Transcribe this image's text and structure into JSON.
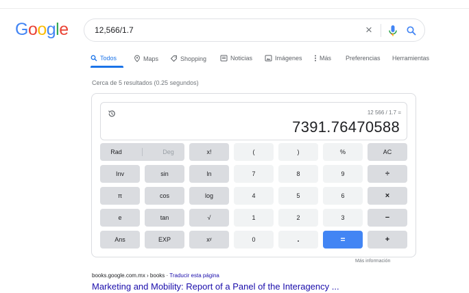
{
  "logo": {
    "letters": [
      "G",
      "o",
      "o",
      "g",
      "l",
      "e"
    ],
    "colors": [
      "#4285f4",
      "#ea4335",
      "#fbbc05",
      "#4285f4",
      "#34a853",
      "#ea4335"
    ]
  },
  "search": {
    "query": "12,566/1.7",
    "clear_icon": "×",
    "mic_icon": "mic-icon",
    "search_icon": "search-icon"
  },
  "tabs": [
    {
      "label": "Todos",
      "icon": "search-icon",
      "active": true
    },
    {
      "label": "Maps",
      "icon": "map-pin-icon",
      "active": false
    },
    {
      "label": "Shopping",
      "icon": "tag-icon",
      "active": false
    },
    {
      "label": "Noticias",
      "icon": "news-icon",
      "active": false
    },
    {
      "label": "Imágenes",
      "icon": "image-icon",
      "active": false
    },
    {
      "label": "Más",
      "icon": "more-vert-icon",
      "active": false
    },
    {
      "label": "Preferencias",
      "icon": "",
      "active": false
    },
    {
      "label": "Herramientas",
      "icon": "",
      "active": false
    }
  ],
  "result_stats": "Cerca de 5 resultados (0.25 segundos)",
  "calculator": {
    "expression": "12 566 / 1.7 =",
    "result": "7391.76470588",
    "rows": [
      [
        {
          "label": "Rad"
        },
        {
          "label": "Deg"
        },
        {
          "label": "x!"
        },
        {
          "label": "("
        },
        {
          "label": ")"
        },
        {
          "label": "%"
        },
        {
          "label": "AC"
        }
      ],
      [
        {
          "label": "Inv"
        },
        {
          "label": "sin"
        },
        {
          "label": "ln"
        },
        {
          "label": "7"
        },
        {
          "label": "8"
        },
        {
          "label": "9"
        },
        {
          "label": "÷"
        }
      ],
      [
        {
          "label": "π"
        },
        {
          "label": "cos"
        },
        {
          "label": "log"
        },
        {
          "label": "4"
        },
        {
          "label": "5"
        },
        {
          "label": "6"
        },
        {
          "label": "×"
        }
      ],
      [
        {
          "label": "e"
        },
        {
          "label": "tan"
        },
        {
          "label": "√"
        },
        {
          "label": "1"
        },
        {
          "label": "2"
        },
        {
          "label": "3"
        },
        {
          "label": "−"
        }
      ],
      [
        {
          "label": "Ans"
        },
        {
          "label": "EXP"
        },
        {
          "label": "xʸ"
        },
        {
          "label": "0"
        },
        {
          "label": "."
        },
        {
          "label": "="
        },
        {
          "label": "+"
        }
      ]
    ],
    "more_info": "Más información"
  },
  "result_item": {
    "cite": "books.google.com.mx › books",
    "cite_sep": " · ",
    "translate": "Traducir esta página",
    "title": "Marketing and Mobility: Report of a Panel of the Interagency ..."
  },
  "colors": {
    "link": "#1a0dab",
    "accent": "#1a73e8",
    "equals_key": "#4285f4"
  }
}
